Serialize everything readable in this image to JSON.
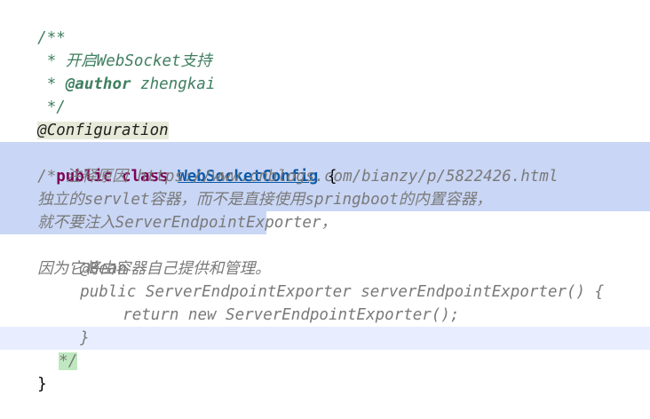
{
  "editor": {
    "lines": [
      "/**",
      " * 开启WebSocket支持",
      " * @author zhengkai",
      " */",
      "@Configuration",
      "public",
      "class",
      "WebSocketConfig",
      "{",
      "/* 注释原因 https://www.cnblogs.com/bianzy/p/5822426.html",
      "独立的servlet容器，而不是直接使用springboot的内置容器，",
      "就不要注入ServerEndpointExporter，",
      "因为它将由容器自己提供和管理。",
      "@Bean",
      "public ServerEndpointExporter serverEndpointExporter() {",
      "return new ServerEndpointExporter();",
      "}",
      "*/",
      "}"
    ],
    "comment_prefix": " * ",
    "javadoc_desc": "开启WebSocket支持",
    "author_tag": "@author",
    "author_name": " zhengkai"
  },
  "colors": {
    "comment": "#3f7f5f",
    "keyword": "#7f0055",
    "class_name": "#0b5aa8",
    "selection": "#c9d6f5",
    "current_line": "#e8eeff"
  }
}
